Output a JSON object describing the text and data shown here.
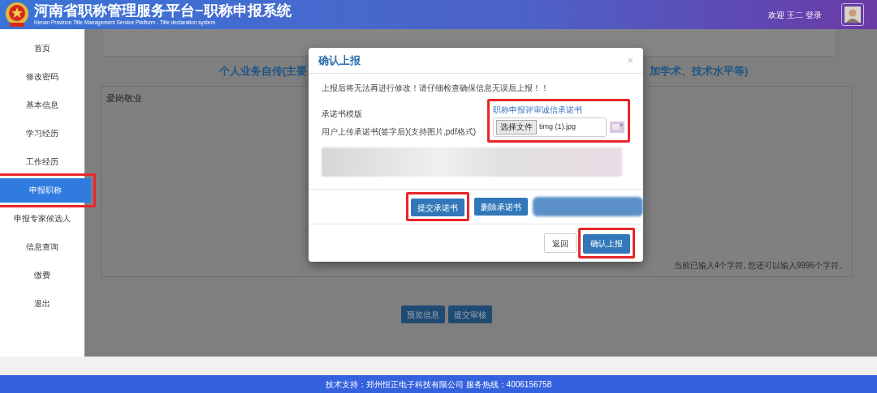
{
  "header": {
    "title": "河南省职称管理服务平台−职称申报系统",
    "subtitle": "Henan Province Title Management Service Platform - Title declaration system",
    "welcome": "欢迎 王二 登录"
  },
  "sidebar": {
    "items": [
      {
        "label": "首页",
        "selected": false
      },
      {
        "label": "修改密码",
        "selected": false
      },
      {
        "label": "基本信息",
        "selected": false
      },
      {
        "label": "学习经历",
        "selected": false
      },
      {
        "label": "工作经历",
        "selected": false
      },
      {
        "label": "申报职称",
        "selected": true
      },
      {
        "label": "申报专家候选人",
        "selected": false
      },
      {
        "label": "信息查询",
        "selected": false
      },
      {
        "label": "缴费",
        "selected": false
      },
      {
        "label": "退出",
        "selected": false
      }
    ]
  },
  "main": {
    "heading_left": "个人业务自传(主要",
    "heading_right": "加学术、技术水平等)",
    "textarea_value": "爱岗敬业",
    "char_count": "当前已输入4个字符, 您还可以输入9996个字符。",
    "buttons": [
      "预览信息",
      "提交审核"
    ]
  },
  "modal": {
    "title": "确认上报",
    "close": "×",
    "warning": "上报后将无法再进行修改！请仔细检查确保信息无误后上报！！",
    "rows": [
      {
        "kind": "link",
        "label": "承诺书模版",
        "link": "职称申报评审诚信承诺书"
      },
      {
        "kind": "file",
        "label": "用户上传承诺书(签字后)(支持图片,pdf格式)",
        "file_button": "选择文件",
        "file_name": "timg (1).jpg"
      }
    ],
    "actions": [
      "提交承诺书",
      "删除承诺书"
    ],
    "footer_buttons": [
      {
        "label": "返回",
        "kind": "default"
      },
      {
        "label": "确认上报",
        "kind": "primary"
      }
    ]
  },
  "footer": {
    "text": "技术支持：郑州恒正电子科技有限公司 服务热线：4006156758"
  }
}
